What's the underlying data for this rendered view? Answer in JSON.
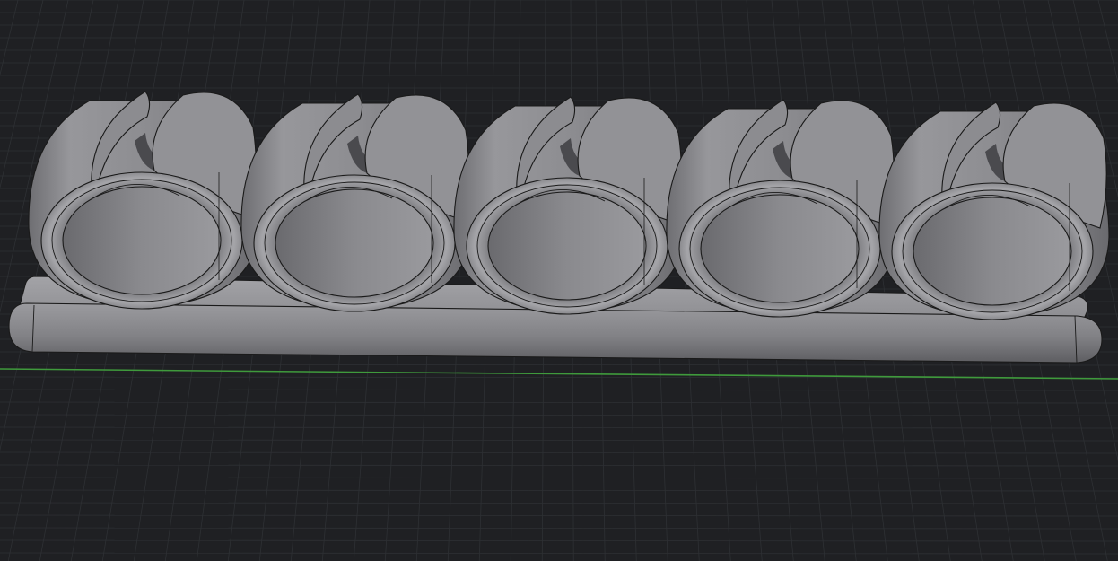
{
  "viewport": {
    "background_color": "#1f2023",
    "grid_color": "#2e3034",
    "axis_color": "#3f9a3c",
    "model_color": "#8e8e92",
    "model_highlight": "#a9a9ad",
    "model_shadow": "#606064",
    "edge_color": "#1a1a1a"
  },
  "model": {
    "clip_count": 5
  }
}
